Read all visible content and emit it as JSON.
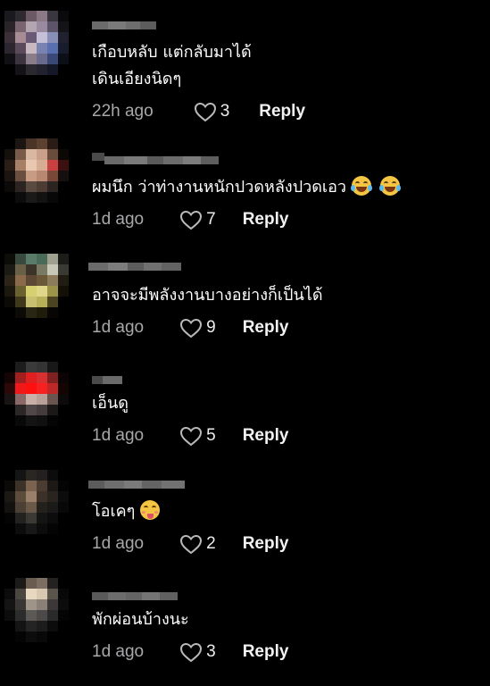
{
  "colors": {
    "background": "#000000",
    "text": "#ffffff",
    "muted": "#a8a8ab",
    "reply": "#f2f2f2"
  },
  "comments": [
    {
      "text_lines": [
        "เกือบหลับ แต่กลับมาได้",
        "เดินเอียงนิดๆ"
      ],
      "time": "22h ago",
      "likes": "3",
      "reply_label": "Reply",
      "emojis": []
    },
    {
      "text_lines": [
        "ผมนึก ว่าท่างานหนักปวดหลังปวดเอว"
      ],
      "time": "1d ago",
      "likes": "7",
      "reply_label": "Reply",
      "emojis": [
        "tears-of-joy-emoji",
        "tears-of-joy-emoji"
      ]
    },
    {
      "text_lines": [
        "อาจจะมีพลังงานบางอย่างก็เป็นได้"
      ],
      "time": "1d ago",
      "likes": "9",
      "reply_label": "Reply",
      "emojis": []
    },
    {
      "text_lines": [
        "เอ็นดู"
      ],
      "time": "1d ago",
      "likes": "5",
      "reply_label": "Reply",
      "emojis": []
    },
    {
      "text_lines": [
        "โอเคๆ"
      ],
      "time": "1d ago",
      "likes": "2",
      "reply_label": "Reply",
      "emojis": [
        "savoring-food-emoji"
      ]
    },
    {
      "text_lines": [
        "พักผ่อนบ้างนะ"
      ],
      "time": "1d ago",
      "likes": "3",
      "reply_label": "Reply",
      "emojis": []
    }
  ]
}
